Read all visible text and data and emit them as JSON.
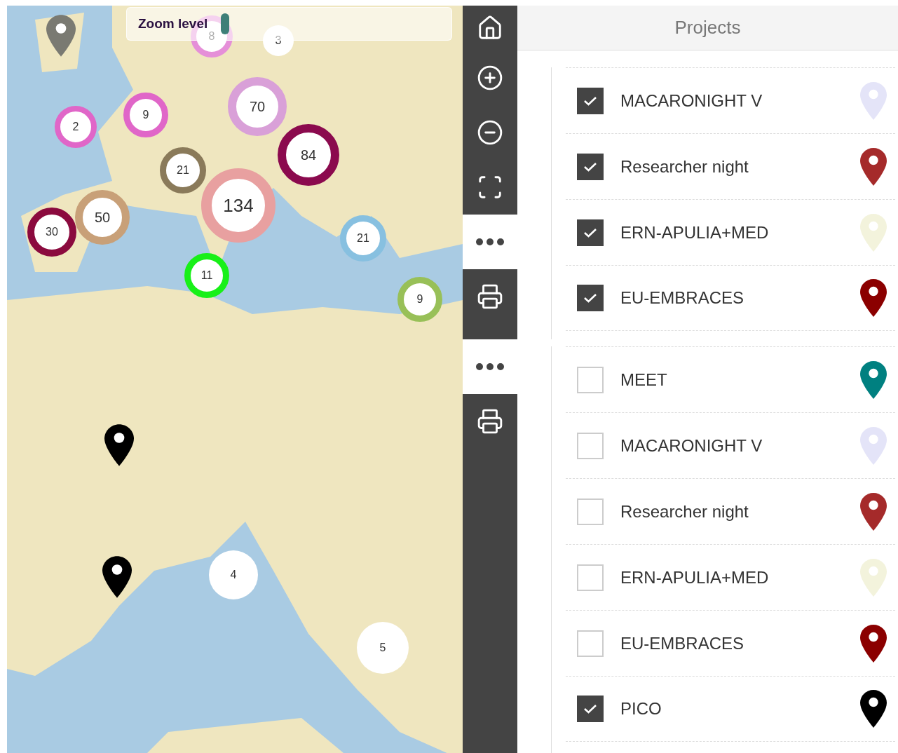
{
  "top_view": {
    "map": {
      "zoom_control": {
        "label": "Zoom level",
        "level": 0.02
      },
      "clusters": [
        {
          "count": "8",
          "color": "#e58fd8"
        },
        {
          "count": "3"
        },
        {
          "count": "2",
          "color": "#e066c8"
        },
        {
          "count": "9",
          "color": "#e066c8"
        },
        {
          "count": "70",
          "color": "#d9a0d8"
        },
        {
          "count": "84",
          "color": "#8b0a4e"
        },
        {
          "count": "21",
          "color": "#8a7a5a"
        },
        {
          "count": "134",
          "color": "#e8a0a0"
        },
        {
          "count": "50",
          "color": "#c8a078"
        },
        {
          "count": "30",
          "color": "#8b0a3e"
        },
        {
          "count": "21",
          "color": "#87c0e0"
        },
        {
          "count": "11",
          "color": "#18f018"
        },
        {
          "count": "9",
          "color": "#98c058"
        }
      ]
    },
    "toolbar": [
      {
        "kind": "home",
        "selected": false
      },
      {
        "kind": "zoom_in",
        "selected": false
      },
      {
        "kind": "zoom_out",
        "selected": false
      },
      {
        "kind": "fullscreen",
        "selected": false
      },
      {
        "kind": "more",
        "selected": true
      },
      {
        "kind": "print",
        "selected": false
      }
    ],
    "projects_panel": {
      "title": "Projects",
      "items": [
        {
          "label": "MACARONIGHT V",
          "checked": true,
          "color": "#e4e4f8"
        },
        {
          "label": "Researcher night",
          "checked": true,
          "color": "#a52a2a"
        },
        {
          "label": "ERN-APULIA+MED",
          "checked": true,
          "color": "#f3f3dc"
        },
        {
          "label": "EU-EMBRACES",
          "checked": true,
          "color": "#8b0000"
        }
      ]
    }
  },
  "bottom_view": {
    "map": {
      "clusters": [
        {
          "count": "4"
        },
        {
          "count": "5"
        }
      ]
    },
    "toolbar": [
      {
        "kind": "more",
        "selected": true
      },
      {
        "kind": "print",
        "selected": false
      }
    ],
    "projects_panel": {
      "items": [
        {
          "label": "MEET",
          "checked": false,
          "color": "#008080"
        },
        {
          "label": "MACARONIGHT V",
          "checked": false,
          "color": "#e4e4f8"
        },
        {
          "label": "Researcher night",
          "checked": false,
          "color": "#a52a2a"
        },
        {
          "label": "ERN-APULIA+MED",
          "checked": false,
          "color": "#f3f3dc"
        },
        {
          "label": "EU-EMBRACES",
          "checked": false,
          "color": "#8b0000"
        },
        {
          "label": "PICO",
          "checked": true,
          "color": "#000000"
        }
      ]
    }
  }
}
